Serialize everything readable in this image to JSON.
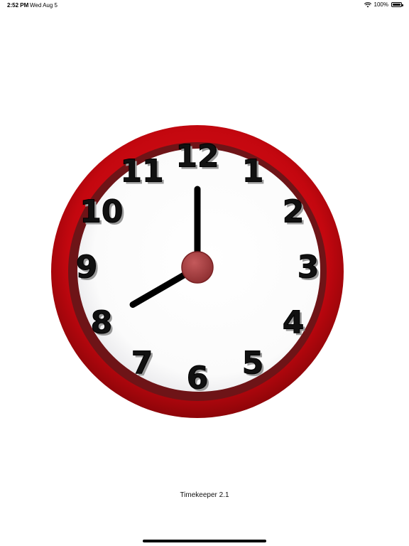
{
  "status_bar": {
    "time": "2:52 PM",
    "date": "Wed Aug 5",
    "battery": "100%",
    "battery_level": 1.0,
    "wifi_icon": "wifi-icon",
    "battery_icon": "battery-icon"
  },
  "clock": {
    "numbers": [
      "12",
      "1",
      "2",
      "3",
      "4",
      "5",
      "6",
      "7",
      "8",
      "9",
      "10",
      "11"
    ],
    "time_shown": {
      "hour": 8,
      "minute": 0
    },
    "colors": {
      "rim": "#c4070f",
      "inner_rim": "#6e1417",
      "face": "#ffffff",
      "hands": "#000000",
      "hub": "#a83a3c"
    }
  },
  "footer": {
    "label": "Timekeeper 2.1"
  }
}
